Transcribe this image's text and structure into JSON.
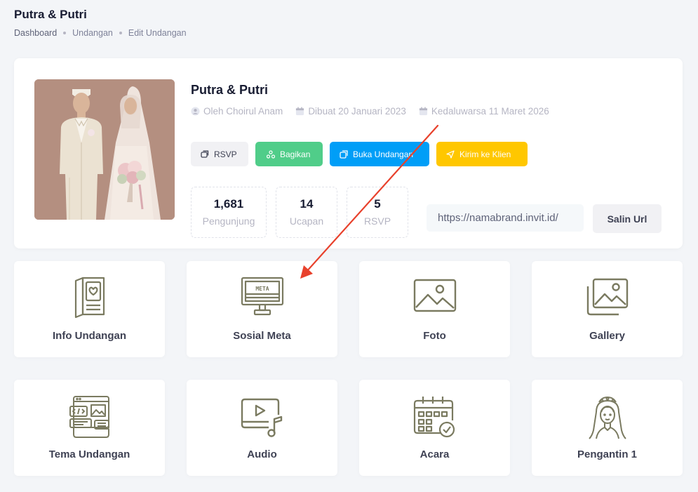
{
  "header": {
    "title": "Putra & Putri",
    "breadcrumb": [
      "Dashboard",
      "Undangan",
      "Edit Undangan"
    ]
  },
  "invitation": {
    "title": "Putra & Putri",
    "author": "Oleh Choirul Anam",
    "created": "Dibuat 20 Januari 2023",
    "expires": "Kedaluwarsa 11 Maret 2026"
  },
  "actions": {
    "rsvp": "RSVP",
    "share": "Bagikan",
    "open": "Buka Undangan",
    "send": "Kirim ke Klien"
  },
  "stats": [
    {
      "value": "1,681",
      "label": "Pengunjung"
    },
    {
      "value": "14",
      "label": "Ucapan"
    },
    {
      "value": "5",
      "label": "RSVP"
    }
  ],
  "url": {
    "value": "https://namabrand.invit.id/",
    "copy_label": "Salin Url"
  },
  "tiles": [
    {
      "label": "Info Undangan",
      "icon": "invitation-card-icon"
    },
    {
      "label": "Sosial Meta",
      "icon": "meta-monitor-icon"
    },
    {
      "label": "Foto",
      "icon": "photo-icon"
    },
    {
      "label": "Gallery",
      "icon": "gallery-icon"
    },
    {
      "label": "Tema Undangan",
      "icon": "theme-layout-icon"
    },
    {
      "label": "Audio",
      "icon": "audio-icon"
    },
    {
      "label": "Acara",
      "icon": "calendar-event-icon"
    },
    {
      "label": "Pengantin 1",
      "icon": "bride-icon"
    }
  ],
  "icon_text": {
    "meta": "META"
  },
  "colors": {
    "accent_blue": "#009ef7",
    "success_green": "#50cd89",
    "warning_yellow": "#ffc700",
    "annotation_red": "#e8412c",
    "icon_olive": "#7a7a60"
  }
}
